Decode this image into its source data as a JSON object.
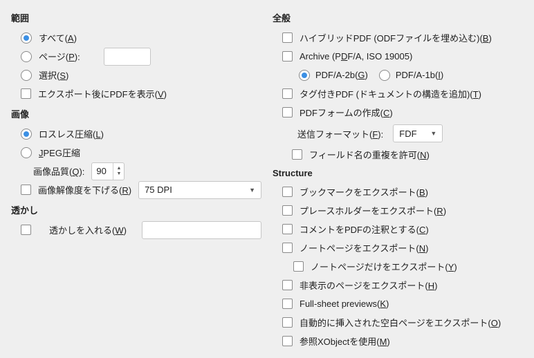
{
  "left": {
    "range": {
      "title": "範囲",
      "all_pre": "すべて(",
      "all_u": "A",
      "all_post": ")",
      "pages_pre": "ページ(",
      "pages_u": "P",
      "pages_post": "):",
      "selection_pre": "選択(",
      "selection_u": "S",
      "selection_post": ")",
      "viewafter_pre": "エクスポート後にPDFを表示(",
      "viewafter_u": "V",
      "viewafter_post": ")"
    },
    "images": {
      "title": "画像",
      "lossless_pre": "ロスレス圧縮(",
      "lossless_u": "L",
      "lossless_post": ")",
      "jpeg_u": "J",
      "jpeg_post": "PEG圧縮",
      "quality_pre": "画像品質(",
      "quality_u": "Q",
      "quality_post": "):",
      "quality_value": "90",
      "reduce_pre": "画像解像度を下げる(",
      "reduce_u": "R",
      "reduce_post": ")",
      "dpi_value": "75 DPI"
    },
    "watermark": {
      "title": "透かし",
      "wm_pre": "透かしを入れる(",
      "wm_u": "W",
      "wm_post": ")"
    }
  },
  "right": {
    "general": {
      "title": "全般",
      "hybrid_pre": "ハイブリッドPDF (ODFファイルを埋め込む)(",
      "hybrid_u": "B",
      "hybrid_post": ")",
      "archive_pre": "Archive (P",
      "archive_u": "D",
      "archive_post": "F/A, ISO 19005)",
      "pdfa2_pre": "PDF/A-2b(",
      "pdfa2_u": "G",
      "pdfa2_post": ")",
      "pdfa1_pre": "PDF/A-1b(",
      "pdfa1_u": "I",
      "pdfa1_post": ")",
      "tagged_pre": "タグ付きPDF (ドキュメントの構造を追加)(",
      "tagged_u": "T",
      "tagged_post": ")",
      "forms_pre": "PDFフォームの作成(",
      "forms_u": "C",
      "forms_post": ")",
      "submit_pre": "送信フォーマット(",
      "submit_u": "F",
      "submit_post": "):",
      "submit_value": "FDF",
      "dup_pre": "フィールド名の重複を許可(",
      "dup_u": "N",
      "dup_post": ")"
    },
    "structure": {
      "title": "Structure",
      "bookmarks_pre": "ブックマークをエクスポート(",
      "bookmarks_u": "B",
      "bookmarks_post": ")",
      "placeholders_pre": "プレースホルダーをエクスポート(",
      "placeholders_u": "R",
      "placeholders_post": ")",
      "comments_pre": "コメントをPDFの注釈とする(",
      "comments_u": "C",
      "comments_post": ")",
      "notes_pre": "ノートページをエクスポート(",
      "notes_u": "N",
      "notes_post": ")",
      "notesonly_pre": "ノートページだけをエクスポート(",
      "notesonly_u": "Y",
      "notesonly_post": ")",
      "hidden_pre": "非表示のページをエクスポート(",
      "hidden_u": "H",
      "hidden_post": ")",
      "fullsheet_pre": "Full-sheet previews(",
      "fullsheet_u": "K",
      "fullsheet_post": ")",
      "autoblank_pre": "自動的に挿入された空白ページをエクスポート(",
      "autoblank_u": "O",
      "autoblank_post": ")",
      "xobject_pre": "参照XObjectを使用(",
      "xobject_u": "M",
      "xobject_post": ")"
    }
  }
}
